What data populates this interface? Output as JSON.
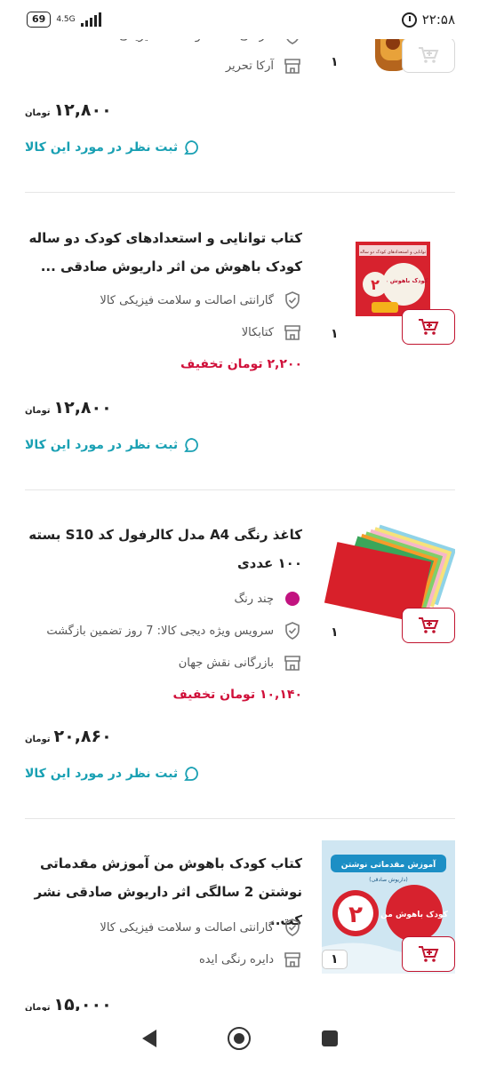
{
  "status_bar": {
    "time": "۲۲:۵۸",
    "battery": "69",
    "network": "4.5G"
  },
  "icons": {
    "cart": "cart-plus-icon",
    "guarantee": "shield-check-icon",
    "seller": "shop-icon",
    "comment": "chat-bubble-icon"
  },
  "colors": {
    "accent": "#c0142f",
    "discount": "#d0103a",
    "comment": "#19a0b3",
    "color_swatch": "#c21380"
  },
  "items": [
    {
      "guarantee_partial": "گارانتی اصالت و سلامت فیزیکی کالا",
      "seller": "آرکا تحریر",
      "quantity": "۱",
      "price": "۱۲,۸۰۰",
      "currency": "تومان",
      "comment": "ثبت نظر در مورد این کالا"
    },
    {
      "title": "کتاب توانایی و استعدادهای کودک دو ساله کودک باهوش من اثر داریوش صادقی ...",
      "guarantee": "گارانتی اصالت و سلامت فیزیکی کالا",
      "seller": "کتابکالا",
      "discount": "۲,۲۰۰ تومان تخفیف",
      "quantity": "۱",
      "price": "۱۲,۸۰۰",
      "currency": "تومان",
      "comment": "ثبت نظر در مورد این کالا"
    },
    {
      "title": "کاغذ رنگی A4 مدل کالرفول کد S10 بسته ۱۰۰ عددی",
      "color": "چند رنگ",
      "service": "سرویس ویژه دیجی کالا: 7 روز تضمین بازگشت",
      "seller": "بازرگانی نقش جهان",
      "discount": "۱۰,۱۴۰ تومان تخفیف",
      "quantity": "۱",
      "price": "۲۰,۸۶۰",
      "currency": "تومان",
      "comment": "ثبت نظر در مورد این کالا"
    },
    {
      "title": "کتاب کودک باهوش من آموزش مقدماتی نوشتن 2 سالگی اثر داریوش صادقی نشر کت..",
      "guarantee": "گارانتی اصالت و سلامت فیزیکی کالا",
      "seller": "دایره رنگی ایده",
      "quantity": "۱",
      "price": "۱۵,۰۰۰",
      "currency": "تومان"
    }
  ],
  "book_covers": {
    "book1_top": "توانایی و استعدادهای کودک دو ساله",
    "book1_main": "کودک باهوش من",
    "book1_num": "۲",
    "book3_top": "آموزش مقدماتی نوشتن",
    "book3_sub": "(داریوش صادقی)",
    "book3_main": "کودک باهوش من",
    "book3_num": "۲"
  }
}
